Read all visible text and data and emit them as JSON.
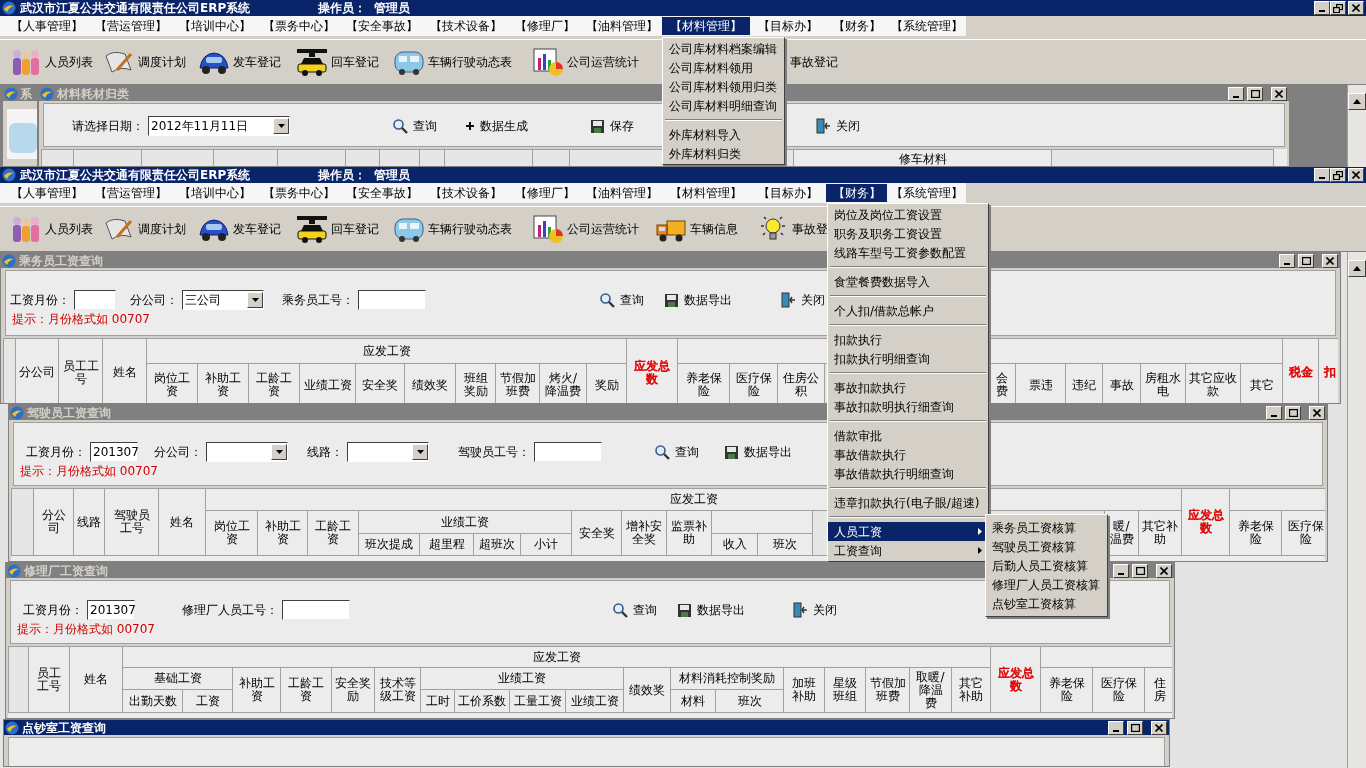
{
  "apps": [
    {
      "title": "武汉市江夏公共交通有限责任公司ERP系统",
      "operator_label": "操作员：",
      "operator": "管理员",
      "menu": [
        {
          "label": "【人事管理】",
          "selected": false
        },
        {
          "label": "【营运管理】",
          "selected": false
        },
        {
          "label": "【培训中心】",
          "selected": false
        },
        {
          "label": "【票务中心】",
          "selected": false
        },
        {
          "label": "【安全事故】",
          "selected": false
        },
        {
          "label": "【技术设备】",
          "selected": false
        },
        {
          "label": "【修理厂】",
          "selected": false
        },
        {
          "label": "【油料管理】",
          "selected": false
        },
        {
          "label": "【材料管理】",
          "selected": true
        },
        {
          "label": "【目标办】",
          "selected": false
        },
        {
          "label": "【财务】",
          "selected": false
        },
        {
          "label": "【系统管理】",
          "selected": false
        }
      ],
      "toolbar": [
        {
          "label": "人员列表",
          "kind": "people"
        },
        {
          "label": "调度计划",
          "kind": "pen"
        },
        {
          "label": "发车登记",
          "kind": "car"
        },
        {
          "label": "回车登记",
          "kind": "taxi"
        },
        {
          "label": "车辆行驶动态表",
          "kind": "bus"
        },
        {
          "label": "公司运营统计",
          "kind": "chart"
        },
        {
          "label": "事故登记"
        }
      ],
      "dropdown": [
        {
          "kind": "item",
          "label": "公司库材料档案编辑",
          "selected": false
        },
        {
          "kind": "item",
          "label": "公司库材料领用",
          "selected": false
        },
        {
          "kind": "item",
          "label": "公司库材料领用归类",
          "selected": false
        },
        {
          "kind": "item",
          "label": "公司库材料明细查询",
          "selected": false
        },
        {
          "kind": "separator"
        },
        {
          "kind": "item",
          "label": "外库材料导入",
          "selected": false
        },
        {
          "kind": "item",
          "label": "外库材料归类",
          "selected": false
        }
      ],
      "background_window": {
        "title": "系"
      },
      "windows": [
        {
          "title": "材料耗材归类",
          "active": false,
          "form": [
            {
              "kind": "select",
              "label": "请选择日期：",
              "value": "2012年11月11日"
            }
          ],
          "buttons": [
            {
              "kind": "search",
              "label": "查询"
            },
            {
              "kind": "plus",
              "label": "数据生成"
            },
            {
              "kind": "save",
              "label": "保存"
            },
            {
              "kind": "door",
              "label": "关闭"
            }
          ],
          "columns": [
            {
              "kind": "blank"
            },
            {
              "kind": "blank"
            },
            {
              "kind": "blank"
            },
            {
              "kind": "blank"
            },
            {
              "kind": "blank"
            },
            {
              "kind": "blank"
            },
            {
              "kind": "blank"
            },
            {
              "kind": "blank"
            },
            {
              "kind": "blank"
            },
            {
              "kind": "blank"
            },
            {
              "kind": "blank"
            },
            {
              "kind": "blank"
            },
            {
              "text": "修车材料"
            },
            {
              "kind": "blank"
            }
          ]
        }
      ]
    },
    {
      "title": "武汉市江夏公共交通有限责任公司ERP系统",
      "operator_label": "操作员：",
      "operator": "管理员",
      "menu": [
        {
          "label": "【人事管理】",
          "selected": false
        },
        {
          "label": "【营运管理】",
          "selected": false
        },
        {
          "label": "【培训中心】",
          "selected": false
        },
        {
          "label": "【票务中心】",
          "selected": false
        },
        {
          "label": "【安全事故】",
          "selected": false
        },
        {
          "label": "【技术设备】",
          "selected": false
        },
        {
          "label": "【修理厂】",
          "selected": false
        },
        {
          "label": "【油料管理】",
          "selected": false
        },
        {
          "label": "【材料管理】",
          "selected": false
        },
        {
          "label": "【目标办】",
          "selected": false
        },
        {
          "label": "【财务】",
          "selected": true
        },
        {
          "label": "【系统管理】",
          "selected": false
        }
      ],
      "toolbar": [
        {
          "label": "人员列表",
          "kind": "people"
        },
        {
          "label": "调度计划",
          "kind": "pen"
        },
        {
          "label": "发车登记",
          "kind": "car"
        },
        {
          "label": "回车登记",
          "kind": "taxi"
        },
        {
          "label": "车辆行驶动态表",
          "kind": "bus"
        },
        {
          "label": "公司运营统计",
          "kind": "chart"
        },
        {
          "label": "车辆信息",
          "kind": "truck"
        },
        {
          "label": "事故登",
          "kind": "bulb"
        }
      ],
      "dropdown": [
        {
          "kind": "item",
          "label": "岗位及岗位工资设置",
          "selected": false
        },
        {
          "kind": "item",
          "label": "职务及职务工资设置",
          "selected": false
        },
        {
          "kind": "item",
          "label": "线路车型号工资参数配置",
          "selected": false
        },
        {
          "kind": "separator"
        },
        {
          "kind": "item",
          "label": "食堂餐费数据导入",
          "selected": false
        },
        {
          "kind": "separator"
        },
        {
          "kind": "item",
          "label": "个人扣/借款总帐户",
          "selected": false
        },
        {
          "kind": "separator"
        },
        {
          "kind": "item",
          "label": "扣款执行",
          "selected": false
        },
        {
          "kind": "item",
          "label": "扣款执行明细查询",
          "selected": false
        },
        {
          "kind": "separator"
        },
        {
          "kind": "item",
          "label": "事故扣款执行",
          "selected": false
        },
        {
          "kind": "item",
          "label": "事故扣款明执行细查询",
          "selected": false
        },
        {
          "kind": "separator"
        },
        {
          "kind": "item",
          "label": "借款审批",
          "selected": false
        },
        {
          "kind": "item",
          "label": "事故借款执行",
          "selected": false
        },
        {
          "kind": "item",
          "label": "事故借款执行明细查询",
          "selected": false
        },
        {
          "kind": "separator"
        },
        {
          "kind": "item",
          "label": "违章扣款执行(电子眼/超速)",
          "selected": false
        },
        {
          "kind": "separator"
        },
        {
          "kind": "item",
          "label": "人员工资",
          "selected": true,
          "children": [
            {
              "label": "乘务员工资核算",
              "selected": false
            },
            {
              "label": "驾驶员工资核算",
              "selected": false
            },
            {
              "label": "后勤人员工资核算",
              "selected": false
            },
            {
              "label": "修理厂人员工资核算",
              "selected": false
            },
            {
              "label": "点钞室工资核算",
              "selected": false
            }
          ]
        },
        {
          "kind": "item",
          "label": "工资查询",
          "selected": false,
          "submenu": true
        }
      ],
      "windows": [
        {
          "title": "乘务员工资查询",
          "active": false,
          "form": [
            {
              "kind": "text",
              "label": "工资月份："
            },
            {
              "kind": "select",
              "label": "分公司：",
              "value": "三公司"
            },
            {
              "kind": "text",
              "label": "乘务员工号："
            }
          ],
          "buttons": [
            {
              "kind": "search",
              "label": "查询"
            },
            {
              "kind": "save",
              "label": "数据导出"
            },
            {
              "kind": "door",
              "label": "关闭"
            }
          ],
          "hint": "提示：月份格式如 00707",
          "columns": [
            {
              "kind": "blank"
            },
            {
              "text": "分公司"
            },
            {
              "text": "员工工号"
            },
            {
              "text": "姓名"
            },
            {
              "text": "应发工资",
              "children": [
                {
                  "text": "岗位工资"
                },
                {
                  "text": "补助工资"
                },
                {
                  "text": "工龄工资"
                },
                {
                  "text": "业绩工资"
                },
                {
                  "text": "安全奖"
                },
                {
                  "text": "绩效奖"
                },
                {
                  "text": "班组奖励"
                },
                {
                  "text": "节假加班费"
                },
                {
                  "text": "烤火/降温费"
                },
                {
                  "text": "奖励"
                }
              ]
            },
            {
              "text": "应发总数",
              "color": "#e00000"
            },
            {
              "children": [
                {
                  "text": "养老保险"
                },
                {
                  "text": "医疗保险"
                },
                {
                  "text": "住房公积"
                },
                {
                  "kind": "blank"
                },
                {
                  "text": "会费"
                },
                {
                  "text": "票违"
                },
                {
                  "text": "违纪"
                },
                {
                  "text": "事故"
                },
                {
                  "text": "房租水电"
                },
                {
                  "text": "其它应收款"
                },
                {
                  "text": "其它"
                }
              ]
            },
            {
              "text": "税金",
              "color": "#e00000"
            },
            {
              "text": "扣",
              "color": "#e00000"
            }
          ]
        },
        {
          "title": "驾驶员工资查询",
          "active": false,
          "form": [
            {
              "kind": "text",
              "label": "工资月份：",
              "value": "201307"
            },
            {
              "kind": "select",
              "label": "分公司："
            },
            {
              "kind": "select",
              "label": "线路："
            },
            {
              "kind": "text",
              "label": "驾驶员工号："
            }
          ],
          "buttons": [
            {
              "kind": "search",
              "label": "查询"
            },
            {
              "kind": "save",
              "label": "数据导出"
            }
          ],
          "hint": "提示：月份格式如 00707",
          "columns": [
            {
              "kind": "blank"
            },
            {
              "text": "分公司"
            },
            {
              "text": "线路"
            },
            {
              "text": "驾驶员工号"
            },
            {
              "text": "姓名"
            },
            {
              "text": "应发工资",
              "children": [
                {
                  "text": "岗位工资"
                },
                {
                  "text": "补助工资"
                },
                {
                  "text": "工龄工资"
                },
                {
                  "text": "业绩工资",
                  "children": [
                    {
                      "text": "班次提成"
                    },
                    {
                      "text": "超里程"
                    },
                    {
                      "text": "超班次"
                    },
                    {
                      "text": "小计"
                    }
                  ]
                },
                {
                  "text": "安全奖"
                },
                {
                  "text": "增补安全奖"
                },
                {
                  "text": "监票补助"
                },
                {
                  "children": [
                    {
                      "text": "收入"
                    },
                    {
                      "text": "班次"
                    }
                  ]
                },
                {
                  "kind": "blank"
                },
                {
                  "text": "暖/温费"
                },
                {
                  "text": "其它补助"
                }
              ]
            },
            {
              "text": "应发总数",
              "color": "#e00000"
            },
            {
              "children": [
                {
                  "text": "养老保险"
                },
                {
                  "text": "医疗保险"
                }
              ]
            }
          ]
        },
        {
          "title": "修理厂工资查询",
          "active": false,
          "form": [
            {
              "kind": "text",
              "label": "工资月份：",
              "value": "201307"
            },
            {
              "kind": "text",
              "label": "修理厂人员工号："
            }
          ],
          "buttons": [
            {
              "kind": "search",
              "label": "查询"
            },
            {
              "kind": "save",
              "label": "数据导出"
            },
            {
              "kind": "door",
              "label": "关闭"
            }
          ],
          "hint": "提示：月份格式如 00707",
          "columns": [
            {
              "kind": "blank"
            },
            {
              "text": "员工工号"
            },
            {
              "text": "姓名"
            },
            {
              "text": "应发工资",
              "children": [
                {
                  "text": "基础工资",
                  "children": [
                    {
                      "text": "出勤天数"
                    },
                    {
                      "text": "工资"
                    }
                  ]
                },
                {
                  "text": "补助工资"
                },
                {
                  "text": "工龄工资"
                },
                {
                  "text": "安全奖励"
                },
                {
                  "text": "技术等级工资"
                },
                {
                  "text": "业绩工资",
                  "children": [
                    {
                      "text": "工时"
                    },
                    {
                      "text": "工价系数"
                    },
                    {
                      "text": "工量工资"
                    },
                    {
                      "text": "业绩工资"
                    }
                  ]
                },
                {
                  "text": "绩效奖"
                },
                {
                  "text": "材料消耗控制奖励",
                  "children": [
                    {
                      "text": "材料"
                    },
                    {
                      "text": "班次"
                    }
                  ]
                },
                {
                  "text": "加班补助"
                },
                {
                  "text": "星级班组"
                },
                {
                  "text": "节假加班费"
                },
                {
                  "text": "取暖/降温费"
                },
                {
                  "text": "其它补助"
                }
              ]
            },
            {
              "text": "应发总数",
              "color": "#e00000"
            },
            {
              "children": [
                {
                  "text": "养老保险"
                },
                {
                  "text": "医疗保险"
                },
                {
                  "text": "住房"
                }
              ]
            }
          ]
        },
        {
          "title": "点钞室工资查询",
          "active": true
        }
      ]
    }
  ]
}
